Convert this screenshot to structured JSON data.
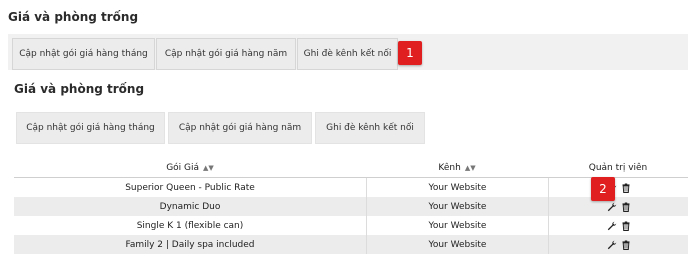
{
  "section1": {
    "title": "Giá và phòng trống",
    "tabs": [
      "Cập nhật gói giá hàng tháng",
      "Cập nhật gói giá hàng năm",
      "Ghi đè kênh kết nối"
    ]
  },
  "section2": {
    "title": "Giá và phòng trống",
    "tabs": [
      "Cập nhật gói giá hàng tháng",
      "Cập nhật gói giá hàng năm",
      "Ghi đè kênh kết nối"
    ]
  },
  "markers": [
    "1",
    "2"
  ],
  "table": {
    "headers": [
      "Gói Giá",
      "Kênh",
      "Quản trị viên"
    ],
    "rows": [
      {
        "rate": "Superior Queen - Public Rate",
        "channel": "Your Website"
      },
      {
        "rate": "Dynamic Duo",
        "channel": "Your Website"
      },
      {
        "rate": "Single K 1 (flexible can)",
        "channel": "Your Website"
      },
      {
        "rate": "Family 2 | Daily spa included",
        "channel": "Your Website"
      }
    ]
  },
  "icons": {
    "edit": "wrench-icon",
    "delete": "trash-icon",
    "sort": "sort-icon"
  },
  "colors": {
    "marker": "#e02020",
    "tab": "#ececec",
    "row_alt": "#ececec"
  }
}
